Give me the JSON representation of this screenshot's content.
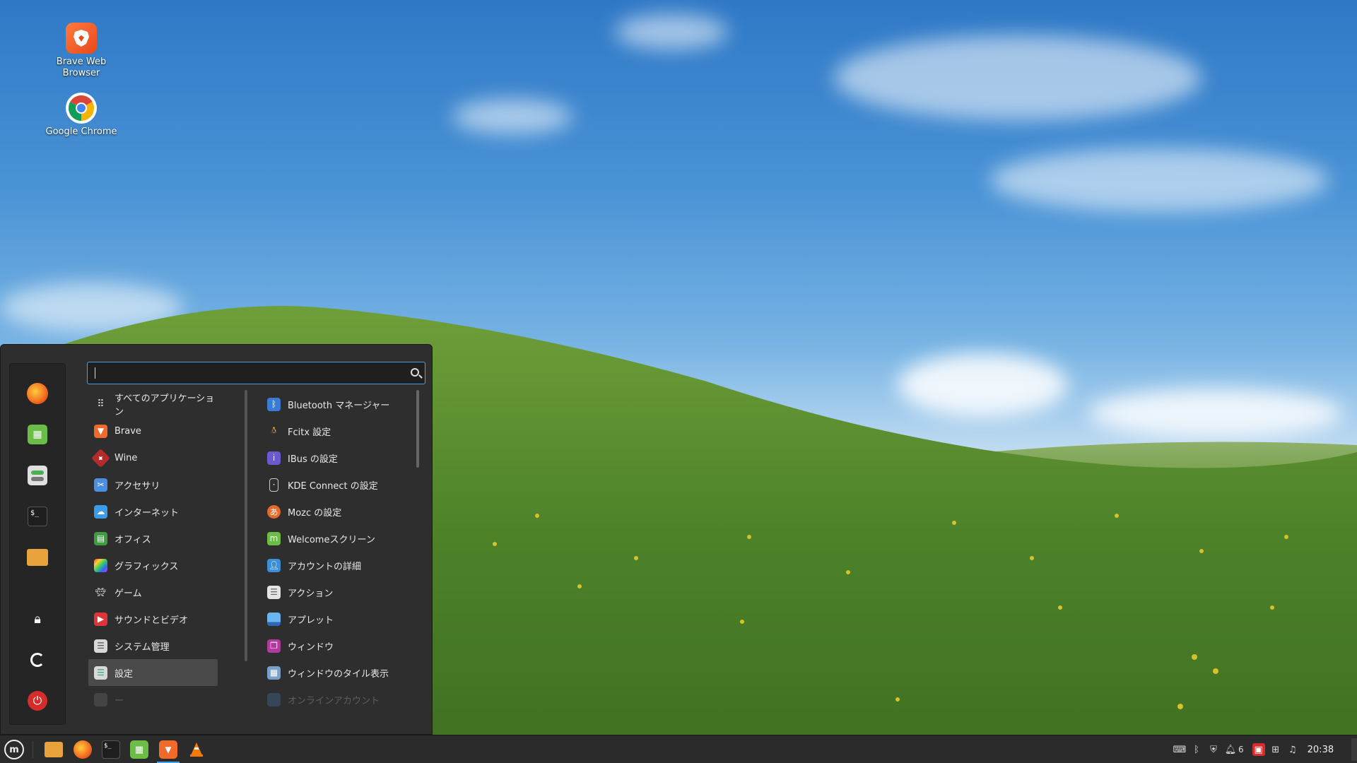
{
  "desktop": {
    "icons": [
      {
        "label": "Brave Web Browser",
        "icon": "brave-lion-icon"
      },
      {
        "label": "Google Chrome",
        "icon": "chrome-icon"
      }
    ]
  },
  "menu": {
    "search": {
      "value": "",
      "placeholder": ""
    },
    "favorites": [
      {
        "icon": "firefox-icon",
        "color": "#f26a21"
      },
      {
        "icon": "calculator-icon",
        "color": "#6cbc48"
      },
      {
        "icon": "settings-toggle-icon",
        "color": "#e0e0e0"
      },
      {
        "icon": "terminal-icon",
        "color": "#1e1e1e"
      },
      {
        "icon": "folder-icon",
        "color": "#e8a33c"
      }
    ],
    "session": [
      {
        "icon": "lock-icon"
      },
      {
        "icon": "logout-icon"
      },
      {
        "icon": "power-icon",
        "color": "#d62c2c"
      }
    ],
    "categories": [
      {
        "label": "すべてのアプリケーション",
        "icon": "grid-icon"
      },
      {
        "label": "Brave",
        "icon": "brave-lion-icon"
      },
      {
        "label": "Wine",
        "icon": "wine-icon"
      },
      {
        "label": "アクセサリ",
        "icon": "accessories-icon"
      },
      {
        "label": "インターネット",
        "icon": "internet-cloud-icon"
      },
      {
        "label": "オフィス",
        "icon": "office-icon"
      },
      {
        "label": "グラフィックス",
        "icon": "graphics-icon"
      },
      {
        "label": "ゲーム",
        "icon": "game-invader-icon"
      },
      {
        "label": "サウンドとビデオ",
        "icon": "play-icon"
      },
      {
        "label": "システム管理",
        "icon": "system-admin-icon"
      },
      {
        "label": "設定",
        "icon": "settings-icon",
        "selected": true
      },
      {
        "label": "ー",
        "icon": "more-icon",
        "faded": true
      }
    ],
    "apps": [
      {
        "label": "Bluetooth マネージャー",
        "icon": "bluetooth-icon"
      },
      {
        "label": "Fcitx 設定",
        "icon": "penguin-icon"
      },
      {
        "label": "IBus の設定",
        "icon": "info-icon"
      },
      {
        "label": "KDE Connect の設定",
        "icon": "phone-icon"
      },
      {
        "label": "Mozc の設定",
        "icon": "mozc-icon"
      },
      {
        "label": "Welcomeスクリーン",
        "icon": "mint-welcome-icon"
      },
      {
        "label": "アカウントの詳細",
        "icon": "account-icon"
      },
      {
        "label": "アクション",
        "icon": "actions-icon"
      },
      {
        "label": "アプレット",
        "icon": "applet-icon"
      },
      {
        "label": "ウィンドウ",
        "icon": "windows-icon"
      },
      {
        "label": "ウィンドウのタイル表示",
        "icon": "tile-icon"
      },
      {
        "label": "オンラインアカウント",
        "icon": "online-accounts-icon",
        "faded": true
      }
    ]
  },
  "taskbar": {
    "launchers": [
      {
        "icon": "files-folder-icon"
      },
      {
        "icon": "firefox-icon"
      },
      {
        "icon": "terminal-icon"
      },
      {
        "icon": "calculator-icon"
      },
      {
        "icon": "brave-lion-icon",
        "active": true
      },
      {
        "icon": "vlc-cone-icon"
      }
    ],
    "tray": {
      "notifications_count": "6",
      "clock": "20:38"
    }
  },
  "colors": {
    "accent": "#4aa3df",
    "menu_bg": "#2e2e2e",
    "panel_bg": "#2b2b2b"
  }
}
